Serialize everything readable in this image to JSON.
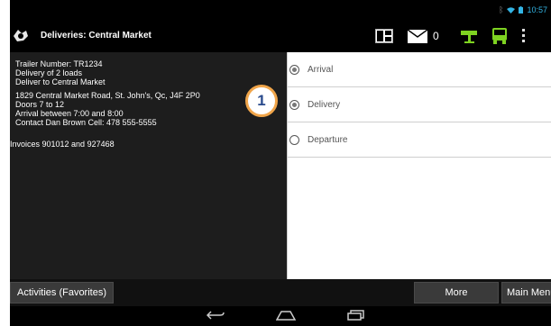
{
  "status_bar": {
    "time": "10:57"
  },
  "action_bar": {
    "title": "Deliveries: Central Market",
    "message_count": "0"
  },
  "trip_details": {
    "lines": [
      "Trailer Number: TR1234",
      "Delivery of 2 loads",
      "Deliver to Central Market",
      "",
      "1829 Central Market Road, St. John's, Qc, J4F 2P0",
      "Doors 7 to 12",
      "Arrival between 7:00 and 8:00",
      "Contact Dan Brown Cell: 478 555-5555",
      "",
      "",
      "Invoices 901012 and 927468"
    ]
  },
  "stop_status": {
    "options": [
      {
        "label": "Arrival",
        "checked": true
      },
      {
        "label": "Delivery",
        "checked": true
      },
      {
        "label": "Departure",
        "checked": false
      }
    ]
  },
  "callout": {
    "number": "1"
  },
  "bottom_bar": {
    "activities_label": "Activities (Favorites)",
    "more_label": "More",
    "main_menu_label": "Main Menu"
  },
  "colors": {
    "accent_green": "#7ed321",
    "callout_border": "#f0a54a",
    "callout_text": "#2a4b8d"
  }
}
